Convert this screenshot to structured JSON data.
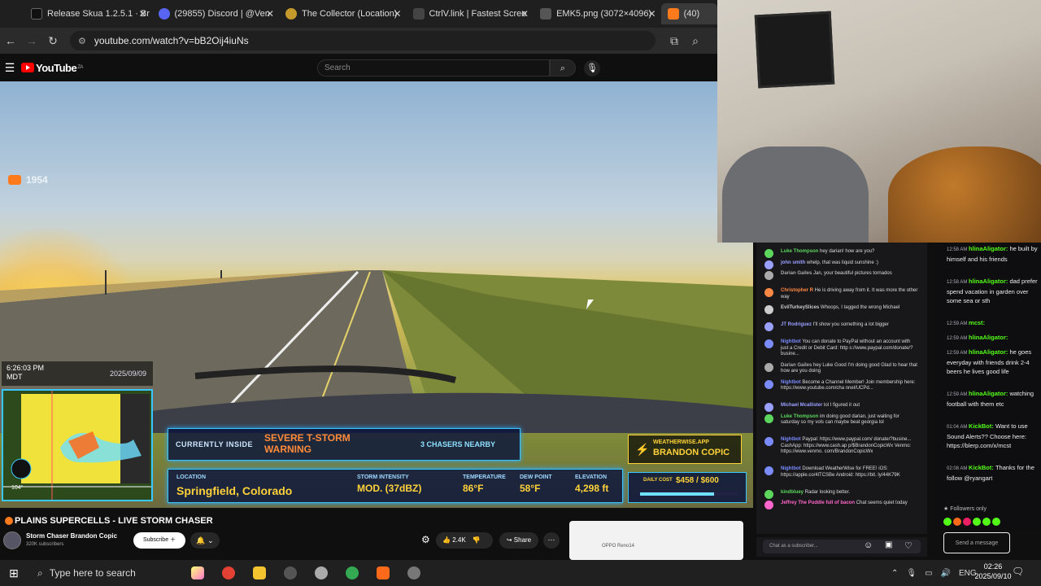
{
  "tabs": [
    {
      "title": "Release Skua 1.2.5.1 · Br",
      "favicon_color": "#1f1f1f"
    },
    {
      "title": "(29855) Discord | @Ven",
      "favicon_color": "#5865f2"
    },
    {
      "title": "The Collector (Location)",
      "favicon_color": "#c69a2a"
    },
    {
      "title": "CtrlV.link | Fastest Scree",
      "favicon_color": "#444"
    },
    {
      "title": "EMK5.png (3072×4096)",
      "favicon_color": "#555"
    },
    {
      "title": "(40)",
      "favicon_color": "#ff7a1a"
    }
  ],
  "address": {
    "url": "youtube.com/watch?v=bB2Oij4iuNs"
  },
  "youtube": {
    "logo": "YouTube",
    "region": "ZA",
    "search_placeholder": "Search"
  },
  "video": {
    "live_count": "1954",
    "time": "6:26:03 PM",
    "tz": "MDT",
    "date": "2025/09/09",
    "currently_inside": "CURRENTLY INSIDE",
    "warning_line1": "SEVERE T-STORM",
    "warning_line2": "WARNING",
    "chasers": "3 CHASERS NEARBY",
    "location_label": "LOCATION",
    "location": "Springfield, Colorado",
    "intensity_label": "STORM INTENSITY",
    "intensity": "MOD. (37dBZ)",
    "temp_label": "TEMPERATURE",
    "temp": "86°F",
    "dew_label": "DEW POINT",
    "dew": "58°F",
    "elev_label": "ELEVATION",
    "elev": "4,298 ft",
    "ww_site": "WEATHERWISE.APP",
    "ww_name": "BRANDON COPIC",
    "cost_label": "DAILY COST",
    "cost": "$458 / $600",
    "cost_fraction": 0.76,
    "radar_speed": "104°"
  },
  "meta": {
    "title": "PLAINS SUPERCELLS - LIVE STORM CHASER",
    "channel": "Storm Chaser Brandon Copic",
    "subscribers": "320K subscribers",
    "subscribe": "Subscribe",
    "likes": "2.4K",
    "share": "Share",
    "ad_text": "OPPO Reno14"
  },
  "chat_left": [
    {
      "name": "Luke Thompson",
      "color": "#5cd65c",
      "text": "hey darian! how are you?"
    },
    {
      "name": "john smith",
      "color": "#9aa0ff",
      "text": "whelp, that was liquid sunshine :)"
    },
    {
      "name": "Darian Gailes",
      "color": "#aaaaaa",
      "text": "Jan, your beautiful pictures tornados"
    },
    {
      "name": "Christopher R",
      "color": "#ff8844",
      "text": "He is driving away from it. It was more the other way"
    },
    {
      "name": "EvilTurkeySlices",
      "color": "#cccccc",
      "text": "Whoops, I tagged the wrong Michael"
    },
    {
      "name": "JT Rodriguez",
      "color": "#9aa0ff",
      "text": "I'll show you something a lot bigger"
    },
    {
      "name": "Nightbot",
      "color": "#7a8cff",
      "text": "You can donate to PayPal without an account with just a Credit or Debit Card: http s://www.paypal.com/donate/?busine..."
    },
    {
      "name": "Darian Gailes",
      "color": "#aaaaaa",
      "text": "hey Luke Good I'm doing good Glad to hear that how are you doing"
    },
    {
      "name": "Nightbot",
      "color": "#7a8cff",
      "text": "Become a Channel Member! Join membership here: https://www.youtube.com/cha nnel/UCPd..."
    },
    {
      "name": "Michael Mcallister",
      "color": "#9aa0ff",
      "text": "lol I figured it out"
    },
    {
      "name": "Luke Thompson",
      "color": "#5cd65c",
      "text": "im doing good darian, just waiting for saturday so my vols can maybe beat georgia lol"
    },
    {
      "name": "Nightbot",
      "color": "#7a8cff",
      "text": "Paypal: https://www.paypal.com/ donate/?busine... CashApp: https://www.cash.ap p/$BrandonCopicWx Venmo: https://www.venmo. com/BrandonCopicWx"
    },
    {
      "name": "Nightbot",
      "color": "#7a8cff",
      "text": "Download WeatherWise for FREE! iOS: https://apple.co/4lTCSBe Android: https://bit. ly/44K79K"
    },
    {
      "name": "kindbluey",
      "color": "#5cd65c",
      "text": "Radar looking better."
    },
    {
      "name": "Jeffrey The Puddle full of bacon",
      "color": "#ff66cc",
      "text": "Chat seems quiet today"
    }
  ],
  "chat_left_input": "Chat as a subscriber...",
  "chat_right": [
    {
      "ts": "12:58 AM",
      "name": "hlinaAligator:",
      "text": "he built by himself and his friends"
    },
    {
      "ts": "12:58 AM",
      "name": "hlinaAligator:",
      "text": "dad prefer spend vacation in garden over some sea or sth"
    },
    {
      "ts": "12:59 AM",
      "name": "mcst:",
      "text": ""
    },
    {
      "ts": "12:59 AM",
      "name": "hlinaAligator:",
      "text": ""
    },
    {
      "ts": "12:59 AM",
      "name": "hlinaAligator:",
      "text": "he goes everyday with friends drink 2-4 beers he lives good life"
    },
    {
      "ts": "12:59 AM",
      "name": "hlinaAligator:",
      "text": "watching football with them etc"
    },
    {
      "ts": "01:04 AM",
      "name": "KickBot:",
      "text": "Want to use Sound Alerts?? Choose here: https://blerp.com/x/mcst"
    },
    {
      "ts": "02:08 AM",
      "name": "KickBot:",
      "text": "Thanks for the follow @ryangart"
    }
  ],
  "followers_only": "Followers only",
  "send_message": "Send a message",
  "taskbar": {
    "search": "Type here to search",
    "lang": "ENG",
    "time": "02:26",
    "date": "2025/09/10"
  },
  "colors": {
    "accent": "#38c8ff",
    "yellow": "#ffd23a",
    "warn": "#ff8a3a",
    "kick": "#53fc18"
  }
}
